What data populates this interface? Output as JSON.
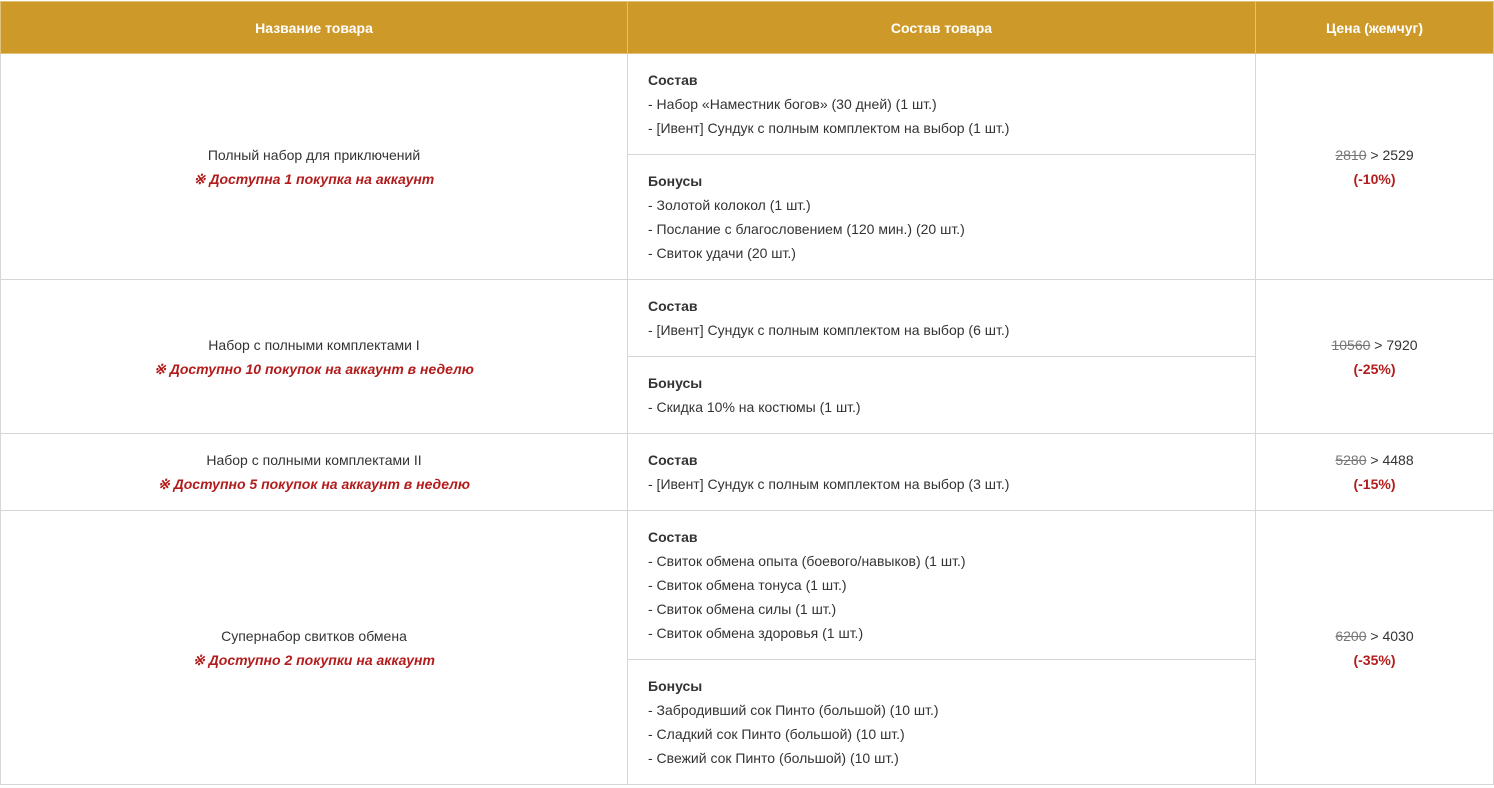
{
  "header": {
    "col_name": "Название товара",
    "col_contents": "Состав товара",
    "col_price": "Цена (жемчуг)"
  },
  "rows": [
    {
      "name": "Полный набор для приключений",
      "limit": "※ Доступна 1 покупка на аккаунт",
      "sections": [
        {
          "title": "Состав",
          "items": [
            "- Набор «Наместник богов» (30 дней) (1 шт.)",
            "- [Ивент] Сундук с полным комплектом на выбор (1 шт.)"
          ]
        },
        {
          "title": "Бонусы",
          "items": [
            "- Золотой колокол (1 шт.)",
            "- Послание с благословением (120 мин.) (20 шт.)",
            "- Свиток удачи (20 шт.)"
          ]
        }
      ],
      "price_old": "2810",
      "price_sep": " > ",
      "price_new": "2529",
      "discount": "(-10%)"
    },
    {
      "name": "Набор с полными комплектами I",
      "limit": "※ Доступно 10 покупок на аккаунт в неделю",
      "sections": [
        {
          "title": "Состав",
          "items": [
            "- [Ивент] Сундук с полным комплектом на выбор (6 шт.)"
          ]
        },
        {
          "title": "Бонусы",
          "items": [
            "- Скидка 10% на костюмы (1 шт.)"
          ]
        }
      ],
      "price_old": "10560",
      "price_sep": " > ",
      "price_new": "7920",
      "discount": "(-25%)"
    },
    {
      "name": "Набор с полными комплектами II",
      "limit": "※ Доступно 5 покупок на аккаунт в неделю",
      "sections": [
        {
          "title": "Состав",
          "items": [
            "- [Ивент] Сундук с полным комплектом на выбор (3 шт.)"
          ]
        }
      ],
      "price_old": "5280",
      "price_sep": " > ",
      "price_new": "4488",
      "discount": "(-15%)"
    },
    {
      "name": "Супернабор свитков обмена",
      "limit": "※ Доступно 2 покупки на аккаунт",
      "sections": [
        {
          "title": "Состав",
          "items": [
            "- Свиток обмена опыта (боевого/навыков) (1 шт.)",
            "- Свиток обмена тонуса (1 шт.)",
            "- Свиток обмена силы (1 шт.)",
            "- Свиток обмена здоровья (1 шт.)"
          ]
        },
        {
          "title": "Бонусы",
          "items": [
            "- Забродивший сок Пинто (большой) (10 шт.)",
            "- Сладкий сок Пинто (большой) (10 шт.)",
            "- Свежий сок Пинто (большой) (10 шт.)"
          ]
        }
      ],
      "price_old": "6200",
      "price_sep": " > ",
      "price_new": "4030",
      "discount": "(-35%)"
    }
  ]
}
